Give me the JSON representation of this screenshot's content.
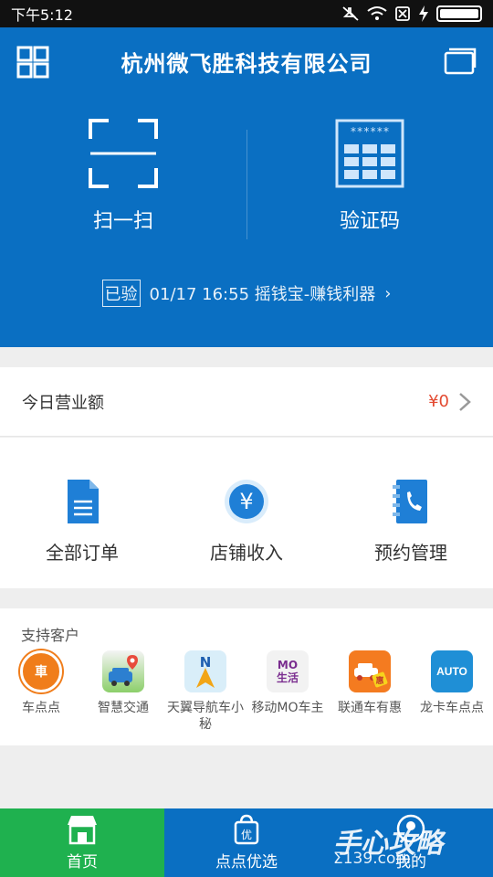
{
  "status_bar": {
    "time": "下午5:12"
  },
  "header": {
    "title": "杭州微飞胜科技有限公司",
    "actions": [
      {
        "label": "扫一扫",
        "icon": "scan-icon"
      },
      {
        "label": "验证码",
        "icon": "keypad-icon",
        "mask": "******"
      }
    ],
    "last_verified": {
      "tag": "已验",
      "text": "01/17 16:55 摇钱宝-赚钱利器",
      "chevron": "›"
    }
  },
  "revenue": {
    "label": "今日营业额",
    "amount": "¥0"
  },
  "menu": [
    {
      "label": "全部订单",
      "icon": "document-icon"
    },
    {
      "label": "店铺收入",
      "icon": "yuan-icon"
    },
    {
      "label": "预约管理",
      "icon": "phone-book-icon"
    }
  ],
  "partners": {
    "heading": "支持客户",
    "items": [
      {
        "name": "车点点",
        "logo_text": "車",
        "color": "#f07d1b"
      },
      {
        "name": "智慧交通",
        "logo_text": "",
        "color": "#8ccf6a"
      },
      {
        "name": "天翼导航车小秘",
        "logo_text": "N",
        "color": "#d9eef9"
      },
      {
        "name": "移动MO车主",
        "logo_text": "MO 生活",
        "color": "#f2f2f2"
      },
      {
        "name": "联通车有惠",
        "logo_text": "惠",
        "color": "#f47b20"
      },
      {
        "name": "龙卡车点点",
        "logo_text": "AUTO",
        "color": "#1f8fd6"
      }
    ]
  },
  "tabbar": {
    "tabs": [
      {
        "label": "首页",
        "icon": "store-icon",
        "active": true
      },
      {
        "label": "点点优选",
        "icon": "shopping-bag-icon",
        "active": false
      },
      {
        "label": "我的",
        "icon": "profile-icon",
        "active": false
      }
    ]
  },
  "watermark": {
    "text": "手心攻略",
    "sub": "Σ139.com"
  },
  "colors": {
    "primary_blue": "#0a6fc2",
    "active_green": "#1fb14f",
    "amount_red": "#e34a31"
  }
}
